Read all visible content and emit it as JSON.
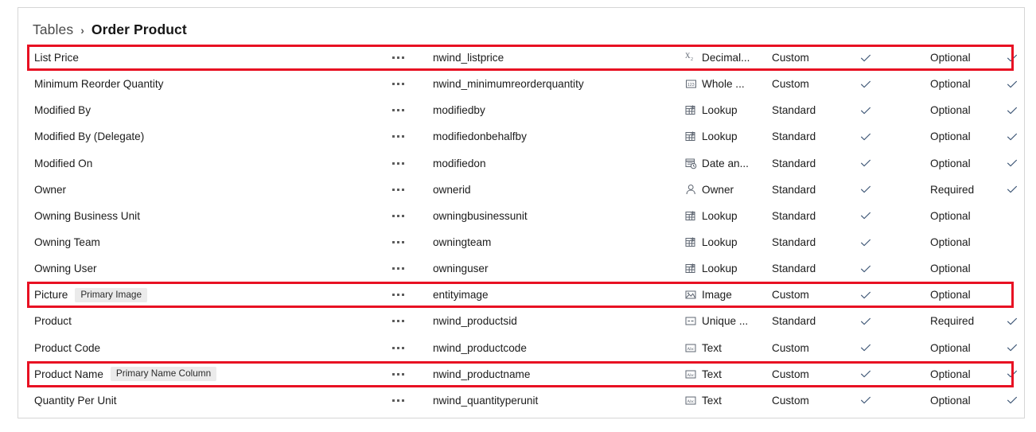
{
  "breadcrumb": {
    "parent": "Tables",
    "separator": "›",
    "current": "Order Product"
  },
  "grid": {
    "rows": [
      {
        "display_name": "List Price",
        "badge": null,
        "menu": "ellipsis-menu",
        "logical_name": "nwind_listprice",
        "data_type": "Decimal...",
        "type_icon": "decimal-icon",
        "custom_standard": "Custom",
        "check1": true,
        "requirement": "Optional",
        "check2": true,
        "highlighted": true
      },
      {
        "display_name": "Minimum Reorder Quantity",
        "badge": null,
        "menu": "ellipsis-menu",
        "logical_name": "nwind_minimumreorderquantity",
        "data_type": "Whole ...",
        "type_icon": "whole-number-icon",
        "custom_standard": "Custom",
        "check1": true,
        "requirement": "Optional",
        "check2": true,
        "highlighted": false
      },
      {
        "display_name": "Modified By",
        "badge": null,
        "menu": "ellipsis-menu",
        "logical_name": "modifiedby",
        "data_type": "Lookup",
        "type_icon": "lookup-icon",
        "custom_standard": "Standard",
        "check1": true,
        "requirement": "Optional",
        "check2": true,
        "highlighted": false
      },
      {
        "display_name": "Modified By (Delegate)",
        "badge": null,
        "menu": "ellipsis-menu",
        "logical_name": "modifiedonbehalfby",
        "data_type": "Lookup",
        "type_icon": "lookup-icon",
        "custom_standard": "Standard",
        "check1": true,
        "requirement": "Optional",
        "check2": true,
        "highlighted": false
      },
      {
        "display_name": "Modified On",
        "badge": null,
        "menu": "ellipsis-menu",
        "logical_name": "modifiedon",
        "data_type": "Date an...",
        "type_icon": "date-time-icon",
        "custom_standard": "Standard",
        "check1": true,
        "requirement": "Optional",
        "check2": true,
        "highlighted": false
      },
      {
        "display_name": "Owner",
        "badge": null,
        "menu": "ellipsis-menu",
        "logical_name": "ownerid",
        "data_type": "Owner",
        "type_icon": "owner-person-icon",
        "custom_standard": "Standard",
        "check1": true,
        "requirement": "Required",
        "check2": true,
        "highlighted": false
      },
      {
        "display_name": "Owning Business Unit",
        "badge": null,
        "menu": "ellipsis-menu",
        "logical_name": "owningbusinessunit",
        "data_type": "Lookup",
        "type_icon": "lookup-icon",
        "custom_standard": "Standard",
        "check1": true,
        "requirement": "Optional",
        "check2": false,
        "highlighted": false
      },
      {
        "display_name": "Owning Team",
        "badge": null,
        "menu": "ellipsis-menu",
        "logical_name": "owningteam",
        "data_type": "Lookup",
        "type_icon": "lookup-icon",
        "custom_standard": "Standard",
        "check1": true,
        "requirement": "Optional",
        "check2": false,
        "highlighted": false
      },
      {
        "display_name": "Owning User",
        "badge": null,
        "menu": "ellipsis-menu",
        "logical_name": "owninguser",
        "data_type": "Lookup",
        "type_icon": "lookup-icon",
        "custom_standard": "Standard",
        "check1": true,
        "requirement": "Optional",
        "check2": false,
        "highlighted": false
      },
      {
        "display_name": "Picture",
        "badge": "Primary Image",
        "menu": "ellipsis-menu",
        "logical_name": "entityimage",
        "data_type": "Image",
        "type_icon": "image-icon",
        "custom_standard": "Custom",
        "check1": true,
        "requirement": "Optional",
        "check2": false,
        "highlighted": true
      },
      {
        "display_name": "Product",
        "badge": null,
        "menu": "ellipsis-menu",
        "logical_name": "nwind_productsid",
        "data_type": "Unique ...",
        "type_icon": "unique-identifier-icon",
        "custom_standard": "Standard",
        "check1": true,
        "requirement": "Required",
        "check2": true,
        "highlighted": false
      },
      {
        "display_name": "Product Code",
        "badge": null,
        "menu": "ellipsis-menu",
        "logical_name": "nwind_productcode",
        "data_type": "Text",
        "type_icon": "text-icon",
        "custom_standard": "Custom",
        "check1": true,
        "requirement": "Optional",
        "check2": true,
        "highlighted": false
      },
      {
        "display_name": "Product Name",
        "badge": "Primary Name Column",
        "menu": "ellipsis-menu",
        "logical_name": "nwind_productname",
        "data_type": "Text",
        "type_icon": "text-icon",
        "custom_standard": "Custom",
        "check1": true,
        "requirement": "Optional",
        "check2": true,
        "highlighted": true
      },
      {
        "display_name": "Quantity Per Unit",
        "badge": null,
        "menu": "ellipsis-menu",
        "logical_name": "nwind_quantityperunit",
        "data_type": "Text",
        "type_icon": "text-icon",
        "custom_standard": "Custom",
        "check1": true,
        "requirement": "Optional",
        "check2": true,
        "highlighted": false
      }
    ]
  },
  "colors": {
    "highlight": "#e81123",
    "text": "#1b1b1b",
    "muted": "#4a4a4a",
    "badge_bg": "#ebebeb",
    "border": "#d6d6d6",
    "check": "#3b5474"
  }
}
